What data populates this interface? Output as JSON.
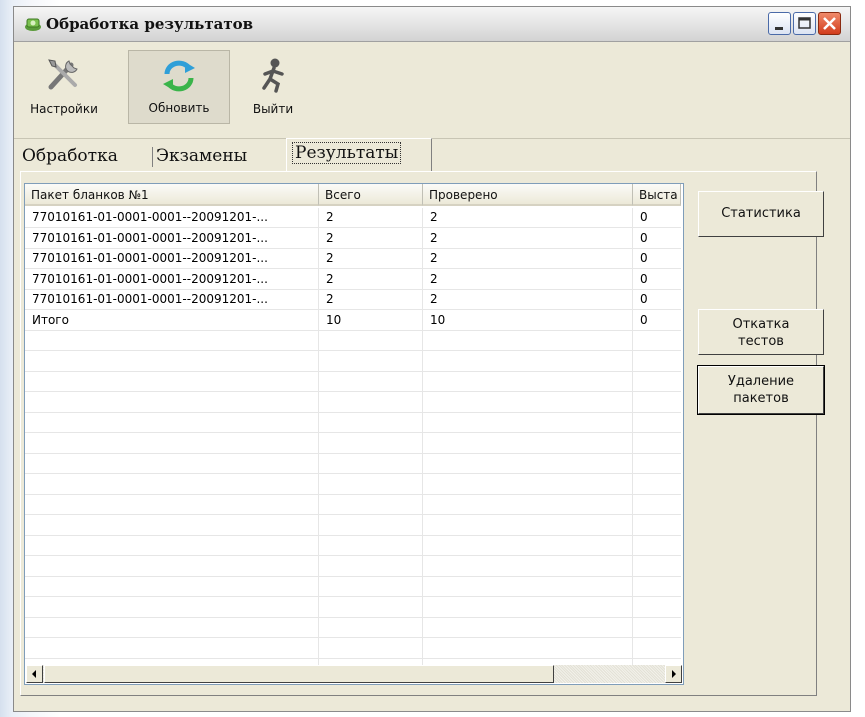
{
  "window": {
    "title": "Обработка результатов"
  },
  "toolbar": {
    "settings_label": "Настройки",
    "refresh_label": "Обновить",
    "exit_label": "Выйти"
  },
  "tabs": [
    {
      "label": "Обработка",
      "active": false
    },
    {
      "label": "Экзамены",
      "active": false
    },
    {
      "label": "Результаты",
      "active": true
    }
  ],
  "table": {
    "columns": [
      "Пакет бланков №1",
      "Всего",
      "Проверено",
      "Выста"
    ],
    "rows": [
      [
        "77010161-01-0001-0001--20091201-...",
        "2",
        "2",
        "0"
      ],
      [
        "77010161-01-0001-0001--20091201-...",
        "2",
        "2",
        "0"
      ],
      [
        "77010161-01-0001-0001--20091201-...",
        "2",
        "2",
        "0"
      ],
      [
        "77010161-01-0001-0001--20091201-...",
        "2",
        "2",
        "0"
      ],
      [
        "77010161-01-0001-0001--20091201-...",
        "2",
        "2",
        "0"
      ],
      [
        "Итого",
        "10",
        "10",
        "0"
      ]
    ]
  },
  "side_buttons": {
    "statistics": "Статистика",
    "rollback": "Откатка\nтестов",
    "delete": "Удаление\nпакетов"
  },
  "icons": {
    "settings": "tools-icon",
    "refresh": "refresh-icon",
    "exit": "running-man-icon"
  }
}
